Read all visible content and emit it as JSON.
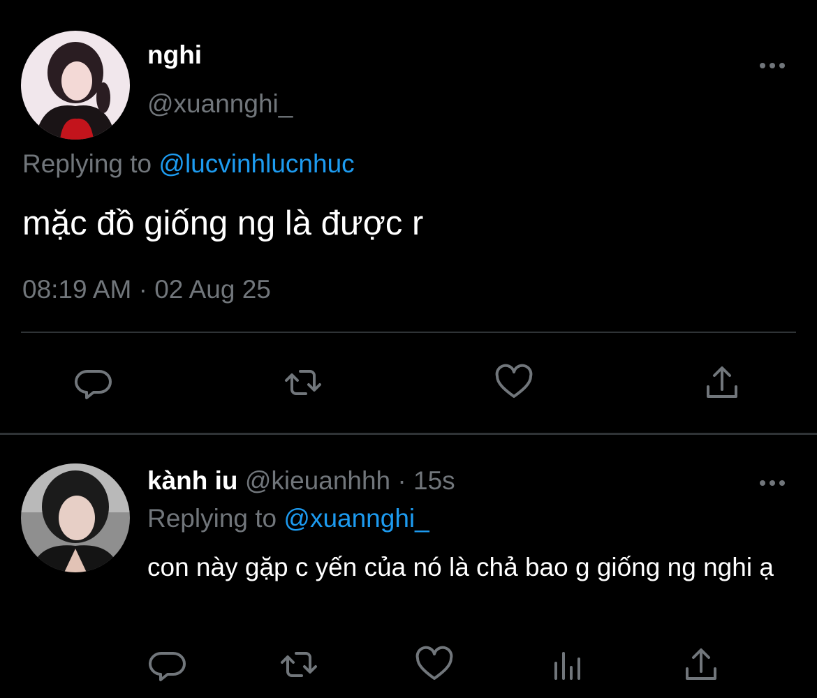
{
  "main_tweet": {
    "display_name": "nghi",
    "handle": "@xuannghi_",
    "replying_prefix": "Replying to",
    "replying_handle": "@lucvinhlucnhuc",
    "text": "mặc đồ giống ng là được r",
    "timestamp": "08:19 AM · 02 Aug 25",
    "more_icon": "more-icon",
    "actions": [
      "reply-icon",
      "retweet-icon",
      "like-icon",
      "share-icon"
    ]
  },
  "reply_tweet": {
    "display_name": "kành iu",
    "handle": "@kieuanhhh",
    "separator": " · ",
    "time_ago": "15s",
    "replying_prefix": "Replying to",
    "replying_handle": "@xuannghi_",
    "text": "con này gặp c yến của nó là chả bao g giống ng nghi ạ",
    "more_icon": "more-icon",
    "actions": [
      "reply-icon",
      "retweet-icon",
      "like-icon",
      "views-icon",
      "share-icon"
    ]
  },
  "colors": {
    "background": "#000000",
    "primary_text": "#ffffff",
    "secondary_text": "#71767b",
    "link": "#1d9bf0",
    "divider": "#2f3336",
    "icon": "#71767b"
  }
}
